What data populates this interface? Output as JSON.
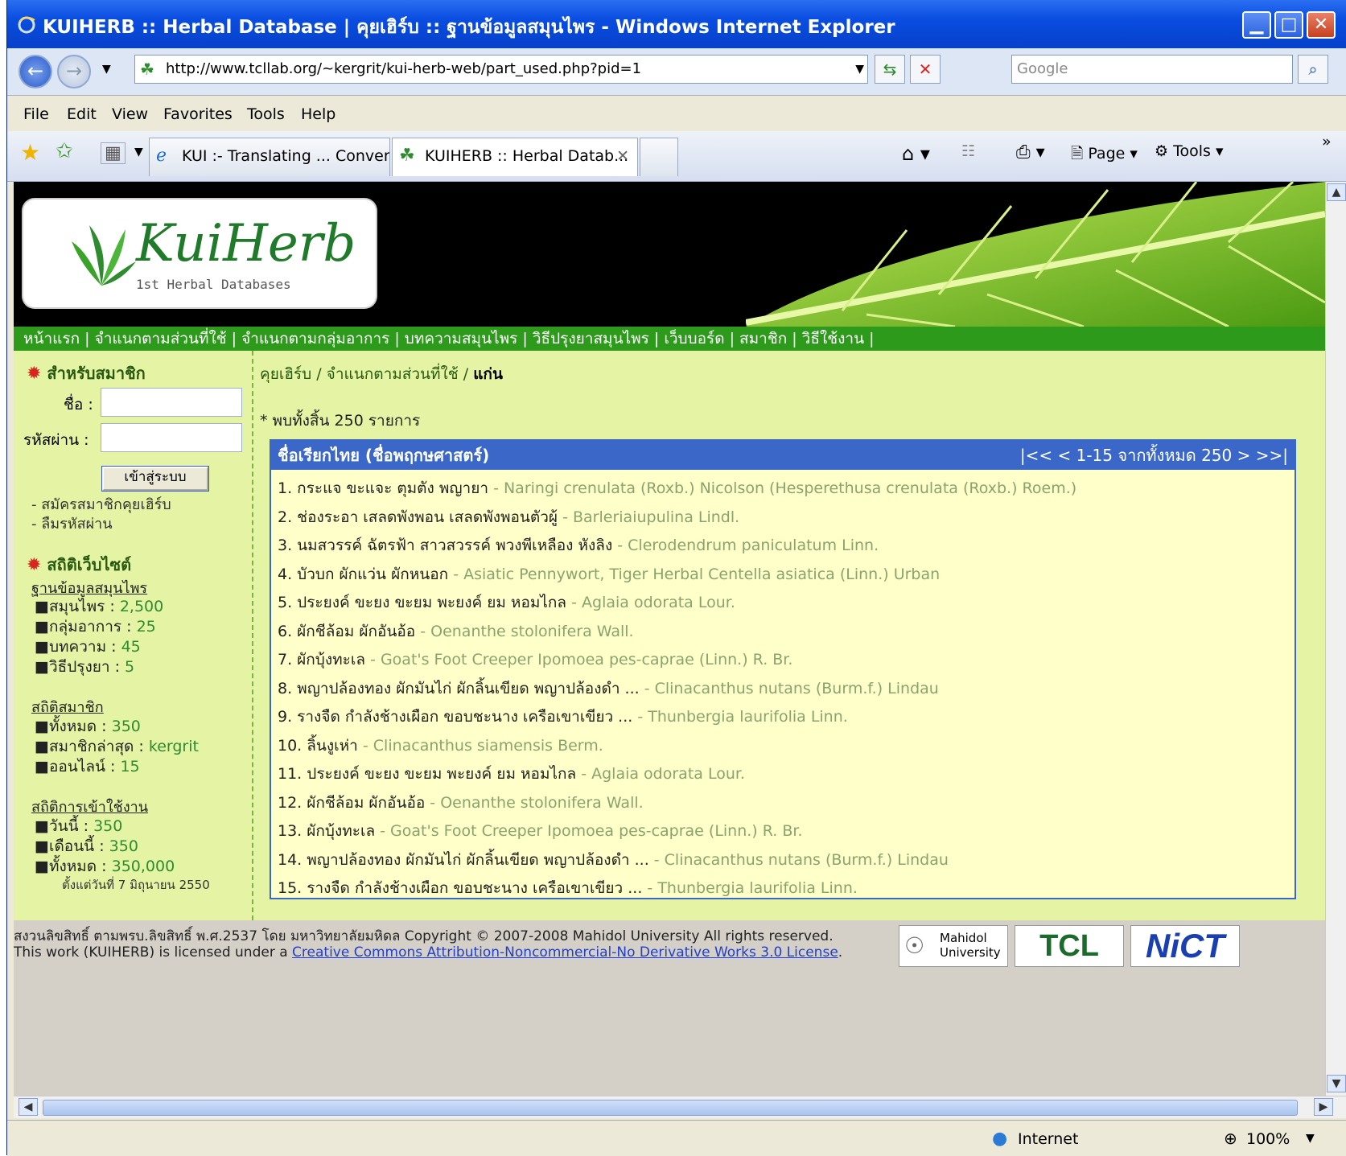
{
  "window": {
    "title": "KUIHERB :: Herbal Database | คุยเฮิร์บ :: ฐานข้อมูลสมุนไพร - Windows Internet Explorer",
    "minimize": "▁",
    "maximize": "□",
    "close": "✕"
  },
  "address": {
    "url": "http://www.tcllab.org/~kergrit/kui-herb-web/part_used.php?pid=1",
    "search_placeholder": "Google"
  },
  "menu": [
    "File",
    "Edit",
    "View",
    "Favorites",
    "Tools",
    "Help"
  ],
  "tabs": [
    {
      "label": "KUI :- Translating ... Conver..."
    },
    {
      "label": "KUIHERB :: Herbal Datab..."
    }
  ],
  "toolbar": {
    "page": "Page",
    "tools": "Tools"
  },
  "site": {
    "brand": "KuiHerb",
    "tagline": "1st Herbal Databases",
    "nav": "หน้าแรก | จำแนกตามส่วนที่ใช้ | จำแนกตามกลุ่มอาการ | บทความสมุนไพร | วิธีปรุงยาสมุนไพร | เว็บบอร์ด | สมาชิก | วิธีใช้งาน |"
  },
  "sidebar": {
    "member_title": "สำหรับสมาชิก",
    "name_label": "ชื่อ :",
    "password_label": "รหัสผ่าน :",
    "login_button": "เข้าสู่ระบบ",
    "register_link": "- สมัครสมาชิกคุยเฮิร์บ",
    "forgot_link": "- ลืมรหัสผ่าน",
    "stats_title": "สถิติเว็บไซต์",
    "db_title": "ฐานข้อมูลสมุนไพร",
    "db_items": [
      {
        "label": "■สมุนไพร : ",
        "value": "2,500"
      },
      {
        "label": "■กลุ่มอาการ : ",
        "value": "25"
      },
      {
        "label": "■บทความ : ",
        "value": "45"
      },
      {
        "label": "■วิธีปรุงยา : ",
        "value": "5"
      }
    ],
    "member_stats_title": "สถิติสมาชิก",
    "member_items": [
      {
        "label": "■ทั้งหมด : ",
        "value": "350"
      },
      {
        "label": "■สมาชิกล่าสุด : ",
        "value": "kergrit"
      },
      {
        "label": "■ออนไลน์ : ",
        "value": "15"
      }
    ],
    "visit_title": "สถิติการเข้าใช้งาน",
    "visit_items": [
      {
        "label": "■วันนี้ : ",
        "value": "350"
      },
      {
        "label": "■เดือนนี้ : ",
        "value": "350"
      },
      {
        "label": "■ทั้งหมด : ",
        "value": "350,000"
      }
    ],
    "since": "ตั้งแต่วันที่ 7 มิถุนายน 2550"
  },
  "main": {
    "crumb_home": "คุยเฮิร์บ",
    "crumb_mid": " / จำแนกตามส่วนที่ใช้ / ",
    "crumb_current": "แก่น",
    "found": "* พบทั้งสิ้น 250 รายการ",
    "table_header": "ชื่อเรียกไทย (ชื่อพฤกษศาสตร์)",
    "pager": "|<< < 1-15 จากทั้งหมด 250 > >>|",
    "rows": [
      {
        "thai": "1. กระแจ ขะแจะ ตุมตัง พญายา",
        "sci": " - Naringi crenulata (Roxb.) Nicolson (Hesperethusa crenulata (Roxb.) Roem.)"
      },
      {
        "thai": "2. ช่องระอา เสลดพังพอน เสลดพังพอนตัวผู้",
        "sci": " - Barleriaiupulina Lindl."
      },
      {
        "thai": "3. นมสวรรค์ ฉัตรฟ้า สาวสวรรค์ พวงพีเหลือง หังลิง",
        "sci": " - Clerodendrum paniculatum Linn."
      },
      {
        "thai": "4. บัวบก ผักแว่น ผักหนอก",
        "sci": " - Asiatic Pennywort, Tiger Herbal Centella asiatica (Linn.) Urban"
      },
      {
        "thai": "5. ประยงค์ ขะยง ขะยม พะยงค์ ยม หอมไกล",
        "sci": " - Aglaia odorata Lour."
      },
      {
        "thai": "6. ผักชีล้อม ผักอันอ้อ",
        "sci": " - Oenanthe stolonifera Wall."
      },
      {
        "thai": "7. ผักบุ้งทะเล",
        "sci": " - Goat's Foot Creeper Ipomoea pes-caprae (Linn.) R. Br."
      },
      {
        "thai": "8. พญาปล้องทอง ผักมันไก่ ผักลิ้นเขียด พญาปล้องดำ ...",
        "sci": " - Clinacanthus nutans (Burm.f.) Lindau"
      },
      {
        "thai": "9. รางจืด กำลังช้างเผือก ขอบชะนาง เครือเขาเขียว ...",
        "sci": " - Thunbergia laurifolia Linn."
      },
      {
        "thai": "10. ลิ้นงูเห่า",
        "sci": " - Clinacanthus siamensis Berm."
      },
      {
        "thai": "11. ประยงค์ ขะยง ขะยม พะยงค์ ยม หอมไกล",
        "sci": " - Aglaia odorata Lour."
      },
      {
        "thai": "12. ผักชีล้อม ผักอันอ้อ",
        "sci": " - Oenanthe stolonifera Wall."
      },
      {
        "thai": "13. ผักบุ้งทะเล",
        "sci": " - Goat's Foot Creeper Ipomoea pes-caprae (Linn.) R. Br."
      },
      {
        "thai": "14. พญาปล้องทอง ผักมันไก่ ผักลิ้นเขียด พญาปล้องดำ ...",
        "sci": " - Clinacanthus nutans (Burm.f.) Lindau"
      },
      {
        "thai": "15. รางจืด กำลังช้างเผือก ขอบชะนาง เครือเขาเขียว ...",
        "sci": " - Thunbergia laurifolia Linn."
      }
    ]
  },
  "footer": {
    "line1": "สงวนลิขสิทธิ์ ตามพรบ.ลิขสิทธิ์ พ.ศ.2537 โดย มหาวิทยาลัยมหิดล Copyright © 2007-2008 Mahidol University All rights reserved.",
    "line2_prefix": "This work (KUIHERB) is licensed under a ",
    "license_link": "Creative Commons Attribution-Noncommercial-No Derivative Works 3.0 License",
    "line2_suffix": ".",
    "logo_mahidol": "Mahidol University",
    "logo_tcl": "TCL",
    "logo_nict": "NiCT"
  },
  "status": {
    "zone": "Internet",
    "zoom": "100%"
  },
  "colors": {
    "nav_green": "#2e9a1c",
    "content_bg": "#e4f4a4",
    "table_header": "#3a67c8",
    "row_bg": "#ffffc9"
  }
}
